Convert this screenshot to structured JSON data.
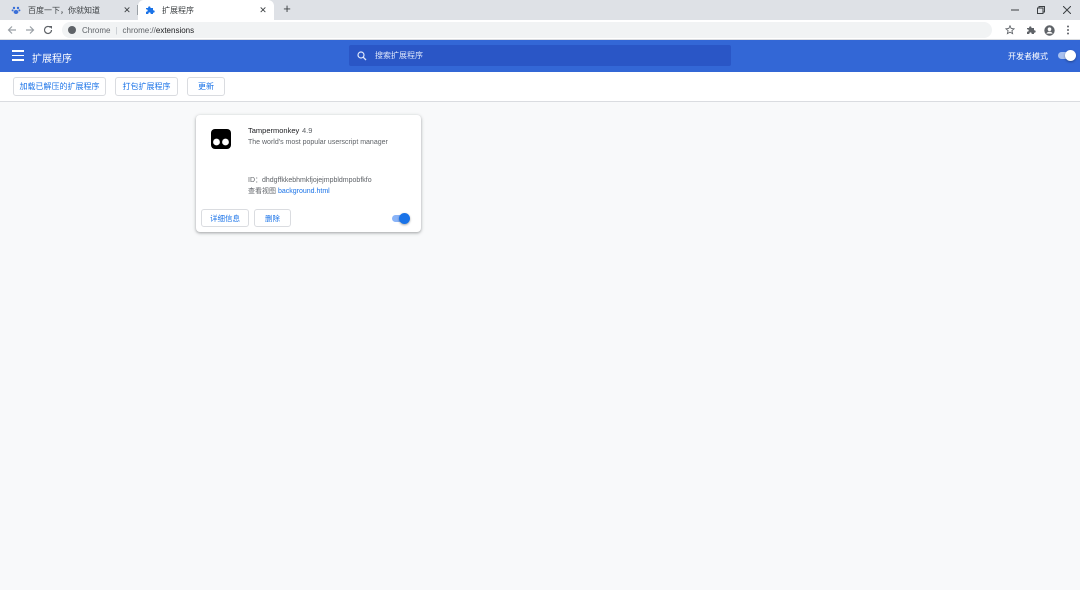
{
  "tabs": [
    {
      "title": "百度一下，你就知道",
      "favicon": "baidu-paw-icon",
      "active": false
    },
    {
      "title": "扩展程序",
      "favicon": "puzzle-icon",
      "active": true
    }
  ],
  "window_controls": [
    "minimize-icon",
    "restore-icon",
    "close-icon"
  ],
  "address_bar": {
    "chip": "Chrome",
    "separator": "|",
    "scheme": "chrome://",
    "path": "extensions"
  },
  "header": {
    "title": "扩展程序",
    "search_placeholder": "搜索扩展程序",
    "dev_mode_label": "开发者模式",
    "dev_mode_on": true,
    "accent_color": "#3367d6"
  },
  "dev_toolbar": {
    "load_unpacked": "加载已解压的扩展程序",
    "pack": "打包扩展程序",
    "update": "更新"
  },
  "extension": {
    "name": "Tampermonkey",
    "version": "4.9",
    "description": "The world's most popular userscript manager",
    "id_label": "ID：",
    "id_value": "dhdgffkkebhmkfjojejmpbldmpobfkfo",
    "inspect_label": "查看视图",
    "inspect_link": "background.html",
    "details_button": "详细信息",
    "remove_button": "删除",
    "enabled": true
  }
}
